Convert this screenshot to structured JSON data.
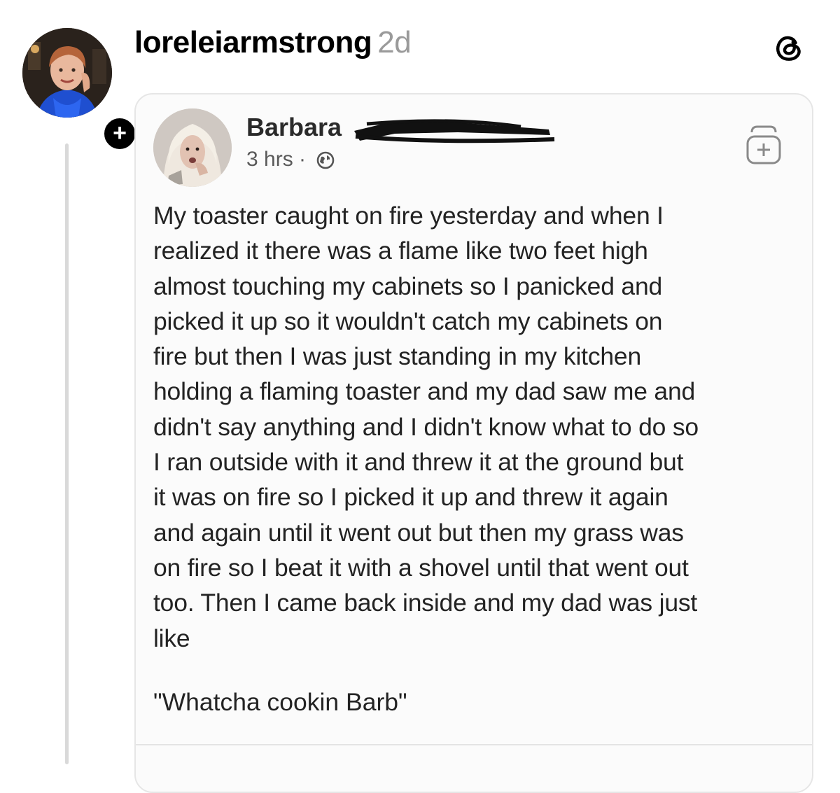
{
  "threads_post": {
    "username": "loreleiarmstrong",
    "time_ago": "2d"
  },
  "facebook_post": {
    "author_name": "Barbara",
    "time": "3 hrs",
    "separator": "·",
    "body": "My toaster caught on fire yesterday and when I\nrealized it there was a flame like two feet high\nalmost touching my cabinets so I panicked and\npicked it up so it wouldn't catch my cabinets on\nfire but then I was just standing in my kitchen\nholding a flaming toaster and my dad saw me and\ndidn't say anything and I didn't know what to do so\nI ran outside with it and threw it at the ground but\nit was on fire so I picked it up and threw it again\nand again until it went out but then my grass was\non fire so I beat it with a shovel until that went out\ntoo. Then I came back inside and my dad was just\nlike",
    "quote": "\"Whatcha cookin Barb\""
  },
  "follow_badge": "+",
  "icons": {
    "threads": "threads-logo-icon",
    "save": "save-icon",
    "privacy": "globe-icon"
  },
  "colors": {
    "timestamp": "#9a9a9a",
    "thread_line": "#d9d9d9",
    "card_border": "#e6e6e6"
  }
}
